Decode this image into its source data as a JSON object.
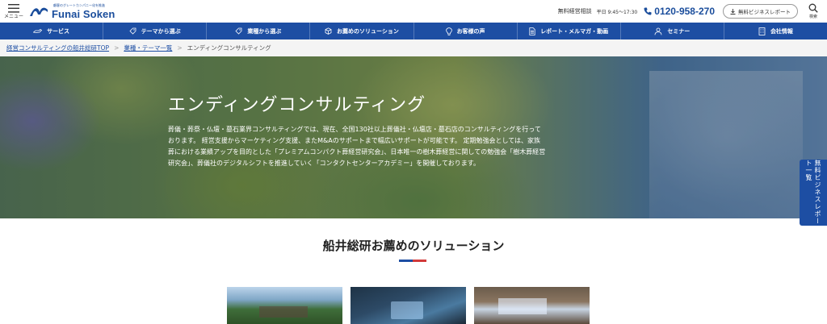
{
  "header": {
    "menu_label": "メニュー",
    "logo_tagline": "顧客のグレートカンパニー化を推進",
    "logo_text": "Funai Soken",
    "consult_label": "無料経営相談",
    "hours": "平日 9:45〜17:30",
    "phone": "0120-958-270",
    "report_button": "無料ビジネスレポート",
    "search_label": "検索"
  },
  "nav": {
    "items": [
      {
        "label": "サービス",
        "icon": "hand-icon"
      },
      {
        "label": "テーマから選ぶ",
        "icon": "tag-icon"
      },
      {
        "label": "業種から選ぶ",
        "icon": "tag-icon"
      },
      {
        "label": "お薦めのソリューション",
        "icon": "box-icon"
      },
      {
        "label": "お客様の声",
        "icon": "bulb-icon"
      },
      {
        "label": "レポート・メルマガ・動画",
        "icon": "document-icon"
      },
      {
        "label": "セミナー",
        "icon": "person-icon"
      },
      {
        "label": "会社情報",
        "icon": "building-icon"
      }
    ]
  },
  "breadcrumb": {
    "items": [
      {
        "label": "経営コンサルティングの船井総研TOP"
      },
      {
        "label": "業種・テーマ一覧"
      }
    ],
    "current": "エンディングコンサルティング"
  },
  "hero": {
    "title": "エンディングコンサルティング",
    "lines": [
      "葬儀・葬祭・仏壇・墓石業界コンサルティングでは、現在、全国130社以上葬儀社・仏壇店・墓石店のコンサルティングを行って",
      "おります。 経営支援からマーケティング支援、またM&Aのサポートまで幅広いサポートが可能です。 定期勉強会としては、家族",
      "葬における業績アップを目的とした「プレミアムコンパクト葬経営研究会」、日本唯一の樹木葬経営に関しての勉強会「樹木葬経営",
      "研究会」、葬儀社のデジタルシフトを推進していく「コンタクトセンターアカデミー」を開催しております。"
    ]
  },
  "side_tab": {
    "label": "無料ビジネスレポート一覧"
  },
  "solutions": {
    "title": "船井総研お薦めのソリューション"
  },
  "colors": {
    "brand": "#1d4ea3",
    "accent_red": "#d23a3a"
  }
}
